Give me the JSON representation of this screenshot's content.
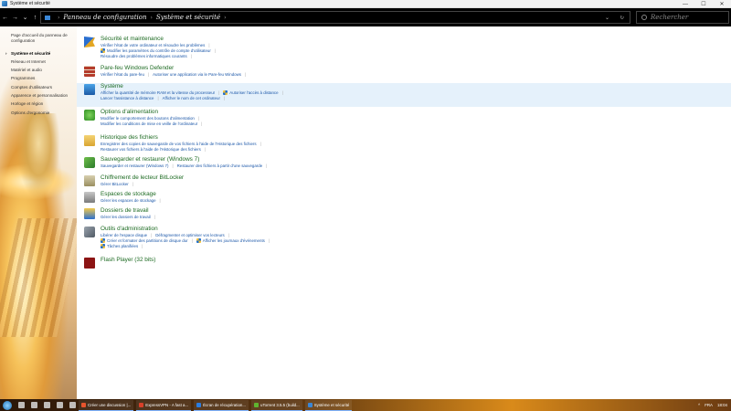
{
  "window": {
    "title": "Système et sécurité",
    "minimize": "—",
    "maximize": "☐",
    "close": "✕"
  },
  "nav": {
    "back": "←",
    "forward": "→",
    "recent": "⌄",
    "up": "↑",
    "breadcrumb": [
      "Panneau de configuration",
      "Système et sécurité"
    ],
    "dropdown": "⌄",
    "refresh": "↻",
    "search_placeholder": "Rechercher"
  },
  "sidebar": {
    "items": [
      {
        "label": "Page d'accueil du panneau de configuration",
        "current": false
      },
      {
        "label": "Système et sécurité",
        "current": true
      },
      {
        "label": "Réseau et Internet",
        "current": false
      },
      {
        "label": "Matériel et audio",
        "current": false
      },
      {
        "label": "Programmes",
        "current": false
      },
      {
        "label": "Comptes d'utilisateurs",
        "current": false
      },
      {
        "label": "Apparence et personnalisation",
        "current": false
      },
      {
        "label": "Horloge et région",
        "current": false
      },
      {
        "label": "Options d'ergonomie",
        "current": false
      }
    ]
  },
  "categories": [
    {
      "title": "Sécurité et maintenance",
      "icon": "flag-icon",
      "highlight": false,
      "lines": [
        [
          {
            "text": "Vérifier l'état de votre ordinateur et résoudre les problèmes",
            "shield": false
          }
        ],
        [
          {
            "text": "Modifier les paramètres du contrôle de compte d'utilisateur",
            "shield": true
          }
        ],
        [
          {
            "text": "Résoudre des problèmes informatiques courants",
            "shield": false
          }
        ]
      ]
    },
    {
      "title": "Pare-feu Windows Defender",
      "icon": "firewall-icon",
      "highlight": false,
      "lines": [
        [
          {
            "text": "Vérifier l'état du pare-feu",
            "shield": false
          },
          {
            "text": "Autoriser une application via le Pare-feu Windows",
            "shield": false
          }
        ]
      ]
    },
    {
      "title": "Système",
      "icon": "system-icon",
      "highlight": true,
      "lines": [
        [
          {
            "text": "Afficher la quantité de mémoire RAM et la vitesse du processeur",
            "shield": false
          },
          {
            "text": "Autoriser l'accès à distance",
            "shield": true
          }
        ],
        [
          {
            "text": "Lancer l'assistance à distance",
            "shield": false
          },
          {
            "text": "Afficher le nom de cet ordinateur",
            "shield": false
          }
        ]
      ]
    },
    {
      "title": "Options d'alimentation",
      "icon": "power-icon",
      "highlight": false,
      "lines": [
        [
          {
            "text": "Modifier le comportement des boutons d'alimentation",
            "shield": false
          }
        ],
        [
          {
            "text": "Modifier les conditions de mise en veille de l'ordinateur",
            "shield": false
          }
        ]
      ]
    },
    {
      "title": "Historique des fichiers",
      "icon": "file-history-icon",
      "highlight": false,
      "lines": [
        [
          {
            "text": "Enregistrer des copies de sauvegarde de vos fichiers à l'aide de l'Historique des fichiers",
            "shield": false
          }
        ],
        [
          {
            "text": "Restaurer vos fichiers à l'aide de l'Historique des fichiers",
            "shield": false
          }
        ]
      ]
    },
    {
      "title": "Sauvegarder et restaurer (Windows 7)",
      "icon": "backup-icon",
      "highlight": false,
      "lines": [
        [
          {
            "text": "Sauvegarder et restaurer (Windows 7)",
            "shield": false
          },
          {
            "text": "Restaurer des fichiers à partir d'une sauvegarde",
            "shield": false
          }
        ]
      ]
    },
    {
      "title": "Chiffrement de lecteur BitLocker",
      "icon": "bitlocker-icon",
      "highlight": false,
      "lines": [
        [
          {
            "text": "Gérer BitLocker",
            "shield": false
          }
        ]
      ]
    },
    {
      "title": "Espaces de stockage",
      "icon": "storage-icon",
      "highlight": false,
      "lines": [
        [
          {
            "text": "Gérer les espaces de stockage",
            "shield": false
          }
        ]
      ]
    },
    {
      "title": "Dossiers de travail",
      "icon": "work-folders-icon",
      "highlight": false,
      "lines": [
        [
          {
            "text": "Gérer les dossiers de travail",
            "shield": false
          }
        ]
      ]
    },
    {
      "title": "Outils d'administration",
      "icon": "admin-tools-icon",
      "highlight": false,
      "lines": [
        [
          {
            "text": "Libérer de l'espace disque",
            "shield": false
          },
          {
            "text": "Défragmenter et optimiser vos lecteurs",
            "shield": false
          }
        ],
        [
          {
            "text": "Créer et formater des partitions de disque dur",
            "shield": true
          },
          {
            "text": "Afficher les journaux d'événements",
            "shield": true
          }
        ],
        [
          {
            "text": "Tâches planifiées",
            "shield": true
          }
        ]
      ]
    },
    {
      "title": "Flash Player (32 bits)",
      "icon": "flash-icon",
      "highlight": false,
      "lines": []
    }
  ],
  "taskbar": {
    "tasks": [
      {
        "label": "Créer une discussion |...",
        "color": "#e8542d"
      },
      {
        "label": "ExpressVPN - A fast a...",
        "color": "#d8402a"
      },
      {
        "label": "Écran de récupération...",
        "color": "#2a7de1"
      },
      {
        "label": "uTorrent 3.5.5 (build...",
        "color": "#5fb52f"
      },
      {
        "label": "Système et sécurité",
        "color": "#3a86d6"
      }
    ],
    "tray": [
      "^",
      "FRA",
      "18:04"
    ]
  },
  "colors": {
    "category_title": "#1c6a21",
    "link": "#1a56a8",
    "highlight_row": "#e5f1fb"
  }
}
